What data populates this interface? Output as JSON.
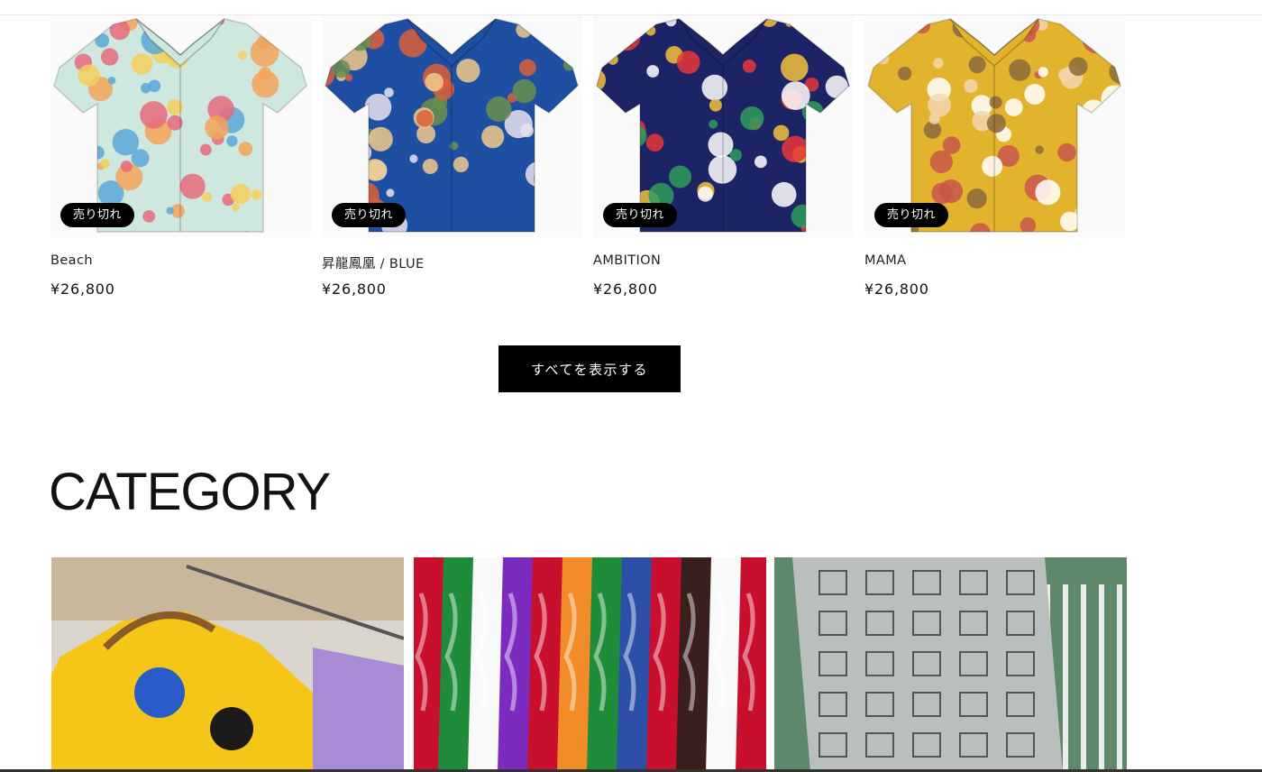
{
  "products": [
    {
      "title": "Beach",
      "price": "¥26,800",
      "badge": "売り切れ",
      "shirt_color": "#cfe8df",
      "pattern_colors": [
        "#f2a35a",
        "#e86a7c",
        "#5ba7d8",
        "#f5cf5b"
      ]
    },
    {
      "title": "昇龍鳳凰 / BLUE",
      "price": "¥26,800",
      "badge": "売り切れ",
      "shirt_color": "#1f4fa3",
      "pattern_colors": [
        "#e7e2f0",
        "#6a8f4d",
        "#f0c98a",
        "#d95f3b"
      ]
    },
    {
      "title": "AMBITION",
      "price": "¥26,800",
      "badge": "売り切れ",
      "shirt_color": "#1c2466",
      "pattern_colors": [
        "#e8373a",
        "#f3c23c",
        "#2f9e5b",
        "#ffffff"
      ]
    },
    {
      "title": "MAMA",
      "price": "¥26,800",
      "badge": "売り切れ",
      "shirt_color": "#e2b32c",
      "pattern_colors": [
        "#f2d6b0",
        "#8c6a3d",
        "#ffffff",
        "#c9564a"
      ]
    }
  ],
  "view_all_label": "すべてを表示する",
  "category": {
    "heading": "CATEGORY",
    "tiles": [
      {
        "name": "yellow-shirts-on-rack",
        "colors": [
          "#f5c518",
          "#2a5cc9",
          "#1b1b1b",
          "#a78bd4"
        ]
      },
      {
        "name": "colorful-aloha-shirts-rack",
        "colors": [
          "#c8102e",
          "#1e8c3a",
          "#7b2cbf",
          "#f9f9f9"
        ]
      },
      {
        "name": "grey-patterned-shirt-outdoor",
        "colors": [
          "#b9bfbd",
          "#2d6a3a",
          "#ececec",
          "#555555"
        ]
      }
    ]
  }
}
